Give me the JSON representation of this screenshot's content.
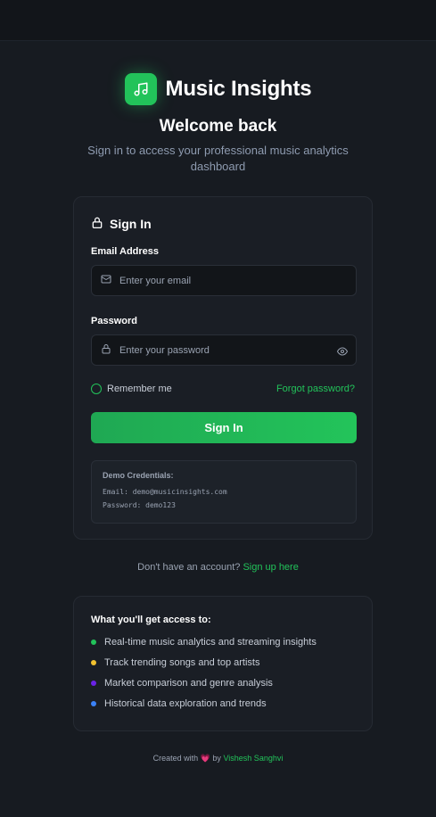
{
  "app": {
    "name": "Music Insights"
  },
  "intro": {
    "title": "Welcome back",
    "subtitle": "Sign in to access your professional music analytics dashboard"
  },
  "signin_card": {
    "title": "Sign In",
    "email": {
      "label": "Email Address",
      "placeholder": "Enter your email",
      "value": ""
    },
    "password": {
      "label": "Password",
      "placeholder": "Enter your password",
      "value": ""
    },
    "remember_label": "Remember me",
    "forgot_label": "Forgot password?",
    "submit_label": "Sign In",
    "demo": {
      "title": "Demo Credentials:",
      "email_line": "Email: demo@musicinsights.com",
      "password_line": "Password: demo123"
    }
  },
  "signup": {
    "prompt": "Don't have an account?",
    "link": "Sign up here"
  },
  "features": {
    "title": "What you'll get access to:",
    "items": [
      {
        "label": "Real-time music analytics and streaming insights",
        "color": "#22c35a"
      },
      {
        "label": "Track trending songs and top artists",
        "color": "#f2c230"
      },
      {
        "label": "Market comparison and genre analysis",
        "color": "#6a22e6"
      },
      {
        "label": "Historical data exploration and trends",
        "color": "#3b82f6"
      }
    ]
  },
  "footer": {
    "prefix": "Created with",
    "heart": "💗",
    "by": "by",
    "author": "Vishesh Sanghvi"
  },
  "colors": {
    "accent": "#22c35a",
    "background": "#171b21",
    "card": "#1a1e25"
  }
}
